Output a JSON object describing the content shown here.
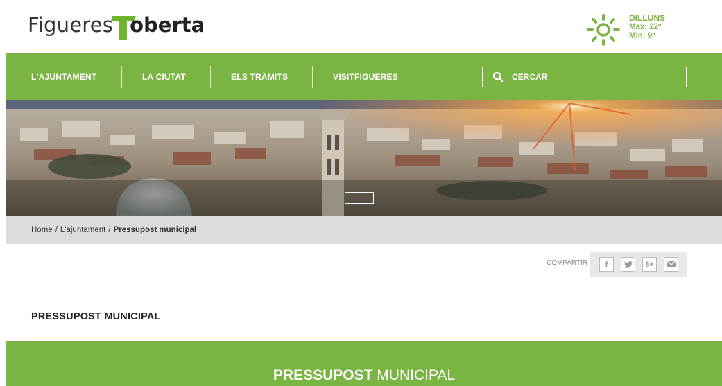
{
  "brand": {
    "logo_light": "Figueres",
    "logo_bold": "oberta",
    "accent_color": "#7ab442"
  },
  "weather": {
    "icon": "sun-icon",
    "day": "DILLUNS",
    "max": "Max: 22º",
    "min": "Min: 9º"
  },
  "nav": {
    "items": [
      {
        "label": "L'AJUNTAMENT"
      },
      {
        "label": "LA CIUTAT"
      },
      {
        "label": "ELS TRÀMITS"
      },
      {
        "label": "VISITFIGUERES"
      }
    ],
    "search_label": "CERCAR",
    "search_icon": "search-icon"
  },
  "breadcrumb": {
    "home": "Home",
    "separator": "/",
    "section": "L'ajuntament",
    "current": "Pressupost municipal"
  },
  "share": {
    "label": "COMPARTIR",
    "buttons": [
      {
        "icon": "facebook-icon",
        "glyph": "f"
      },
      {
        "icon": "twitter-icon",
        "glyph": "t"
      },
      {
        "icon": "google-plus-icon",
        "glyph": "8+"
      },
      {
        "icon": "email-icon",
        "glyph": "✉"
      }
    ]
  },
  "page": {
    "title": "PRESSUPOST MUNICIPAL"
  },
  "section": {
    "title_bold": "PRESSUPOST",
    "title_normal": "MUNICIPAL"
  }
}
